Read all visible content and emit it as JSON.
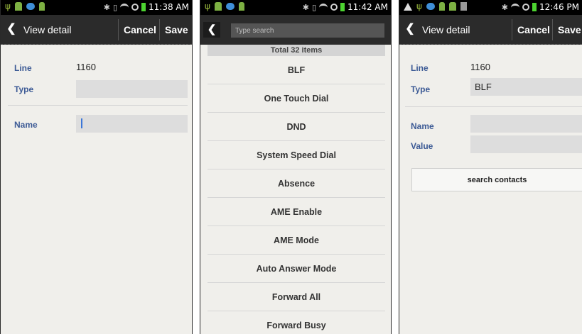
{
  "screens": [
    {
      "statusbar": {
        "time": "11:38 AM"
      },
      "actionbar": {
        "title": "View detail",
        "cancel": "Cancel",
        "save": "Save"
      },
      "fields": {
        "line_label": "Line",
        "line_value": "1160",
        "type_label": "Type",
        "type_value": "",
        "name_label": "Name",
        "name_value": ""
      }
    },
    {
      "statusbar": {
        "time": "11:42 AM"
      },
      "search": {
        "placeholder": "Type search"
      },
      "total": "Total 32 items",
      "items": [
        "BLF",
        "One Touch Dial",
        "DND",
        "System Speed Dial",
        "Absence",
        "AME Enable",
        "AME Mode",
        "Auto Answer Mode",
        "Forward All",
        "Forward Busy"
      ]
    },
    {
      "statusbar": {
        "time": "12:46 PM"
      },
      "actionbar": {
        "title": "View detail",
        "cancel": "Cancel",
        "save": "Save"
      },
      "fields": {
        "line_label": "Line",
        "line_value": "1160",
        "type_label": "Type",
        "type_value": "BLF",
        "name_label": "Name",
        "name_value": "",
        "value_label": "Value",
        "value_value": ""
      },
      "button": "search contacts"
    }
  ],
  "icons": [
    "usb-icon",
    "android-icon",
    "voicemail-icon",
    "battery-icon",
    "bluetooth-icon",
    "vibrate-icon",
    "wifi-icon",
    "no-sync-icon",
    "warning-icon",
    "back-icon"
  ],
  "colors": {
    "label_blue": "#3c5a95",
    "actionbar": "#2b2b2b",
    "background": "#f0efeb",
    "field": "#dddddd"
  }
}
